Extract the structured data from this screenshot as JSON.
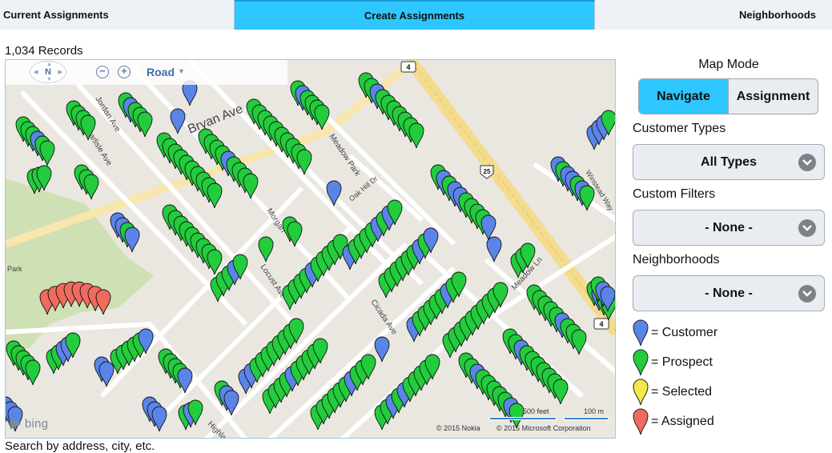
{
  "tabs": [
    {
      "label": "Current Assignments"
    },
    {
      "label": "Create Assignments"
    },
    {
      "label": "Neighborhoods"
    }
  ],
  "records": "1,034 Records",
  "map": {
    "compass": "N",
    "road_label": "Road",
    "street_labels": [
      "Bryan Ave",
      "Jordan Ave",
      "Carlisle Ave",
      "Morgan",
      "Oak Hill Dr",
      "Meadow Park",
      "Locust Ave",
      "Cicada Ave",
      "Meadow Ln",
      "Highland",
      "Winstead Way",
      "Park"
    ],
    "route_shields": [
      "4",
      "25",
      "4"
    ],
    "attribution_logo": "bing",
    "copyright_1": "© 2015 Nokia",
    "copyright_2": "© 2015 Microsoft Corporation",
    "scale_1": "500 feet",
    "scale_2": "100 m"
  },
  "panel": {
    "map_mode_title": "Map Mode",
    "navigate_label": "Navigate",
    "assignment_label": "Assignment",
    "customer_types_label": "Customer Types",
    "customer_types_value": "All Types",
    "custom_filters_label": "Custom Filters",
    "custom_filters_value": "- None -",
    "neighborhoods_label": "Neighborhoods",
    "neighborhoods_value": "- None -"
  },
  "legend": [
    {
      "label": "= Customer",
      "color": "#5b84e8"
    },
    {
      "label": "= Prospect",
      "color": "#22cc3c"
    },
    {
      "label": "= Selected",
      "color": "#f5e84a"
    },
    {
      "label": "= Assigned",
      "color": "#ef6b5d"
    }
  ],
  "search_hint": "Search by address, city, etc.",
  "colors": {
    "accent": "#2ec7ff",
    "customer_pin": "#5b84e8",
    "prospect_pin": "#22cc3c",
    "selected_pin": "#f5e84a",
    "assigned_pin": "#ef6b5d"
  }
}
